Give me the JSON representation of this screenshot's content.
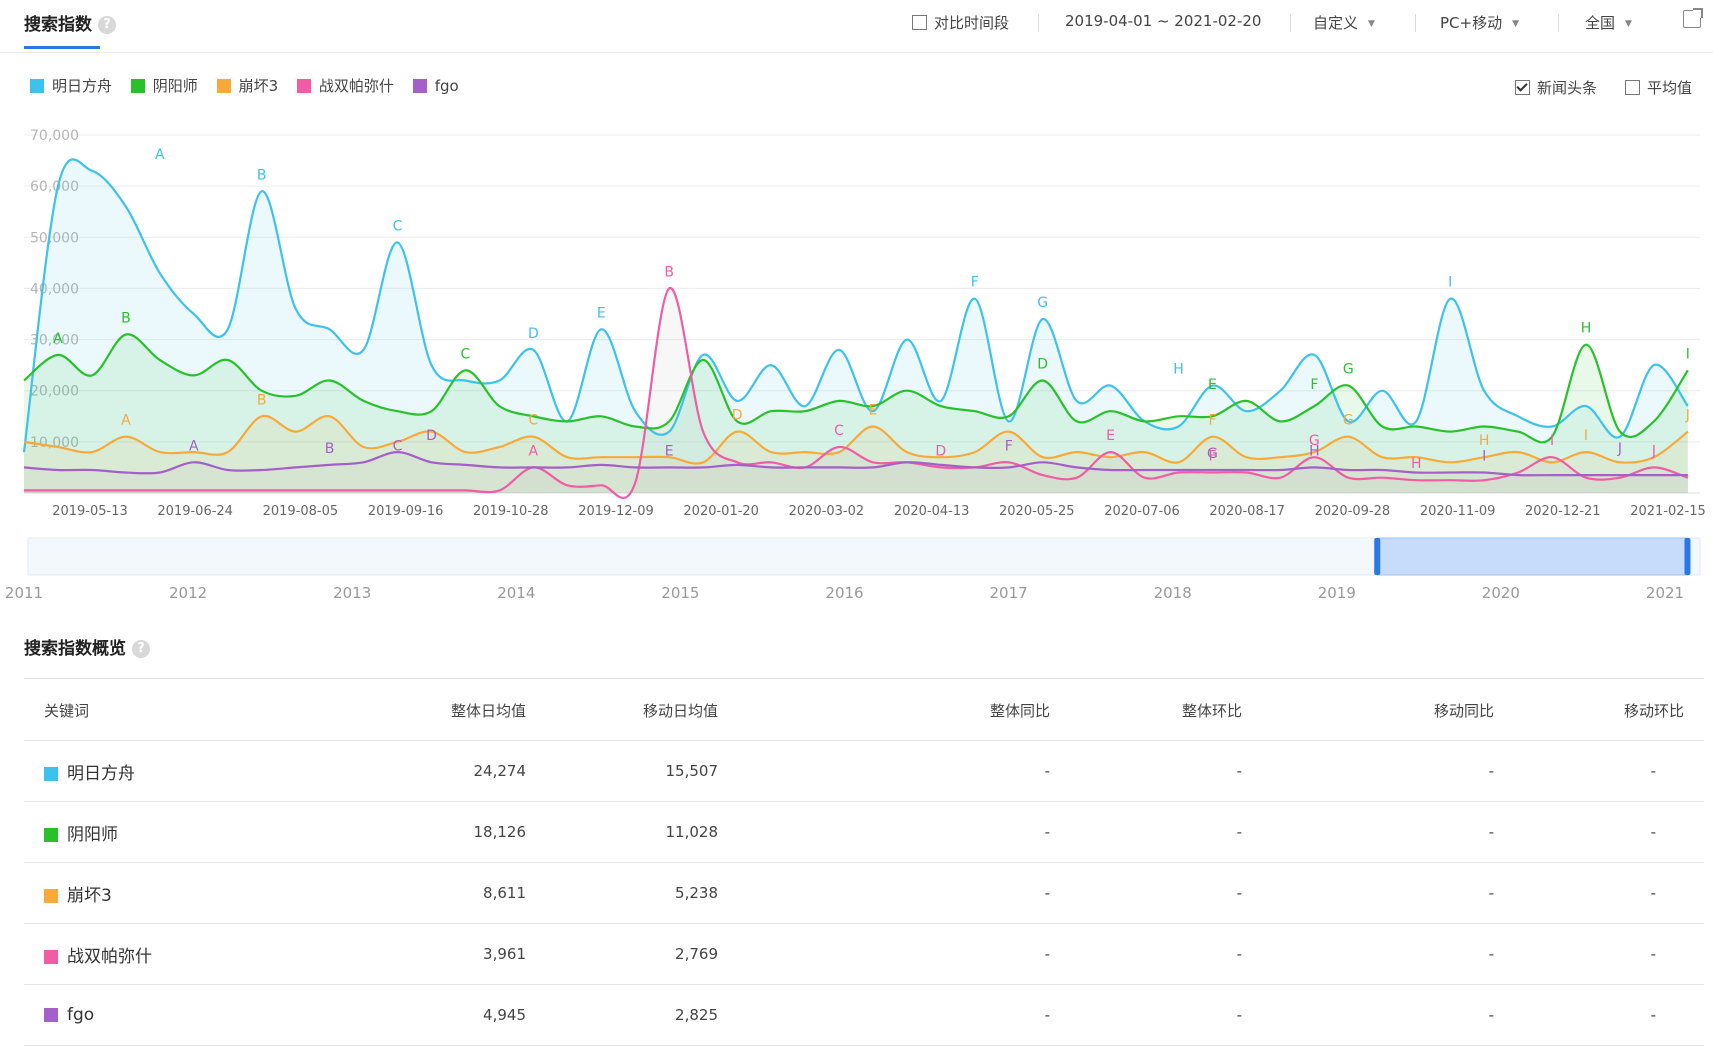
{
  "header": {
    "title": "搜索指数",
    "help_icon": "?",
    "compare_label": "对比时间段",
    "date_range": "2019-04-01 ~ 2021-02-20",
    "custom_label": "自定义",
    "device_label": "PC+移动",
    "region_label": "全国"
  },
  "legend": {
    "items": [
      {
        "name": "明日方舟",
        "color": "#3cc2ec"
      },
      {
        "name": "阴阳师",
        "color": "#28c12a"
      },
      {
        "name": "崩坏3",
        "color": "#f7a93a"
      },
      {
        "name": "战双帕弥什",
        "color": "#f15ca4"
      },
      {
        "name": "fgo",
        "color": "#a55fc8"
      }
    ],
    "news_label": "新闻头条",
    "news_checked": true,
    "avg_label": "平均值",
    "avg_checked": false
  },
  "chart_data": {
    "type": "line",
    "title": "",
    "ylim": [
      0,
      70000
    ],
    "yticks": [
      "70,000",
      "60,000",
      "50,000",
      "40,000",
      "30,000",
      "20,000",
      "10,000"
    ],
    "xtick_labels": [
      "2019-05-13",
      "2019-06-24",
      "2019-08-05",
      "2019-09-16",
      "2019-10-28",
      "2019-12-09",
      "2020-01-20",
      "2020-03-02",
      "2020-04-13",
      "2020-05-25",
      "2020-07-06",
      "2020-08-17",
      "2020-09-28",
      "2020-11-09",
      "2020-12-21",
      "2021-02-15"
    ],
    "x": [
      "2019-04-01",
      "2019-04-15",
      "2019-04-29",
      "2019-05-13",
      "2019-05-27",
      "2019-06-10",
      "2019-06-24",
      "2019-07-08",
      "2019-07-22",
      "2019-08-05",
      "2019-08-19",
      "2019-09-02",
      "2019-09-16",
      "2019-09-30",
      "2019-10-14",
      "2019-10-28",
      "2019-11-11",
      "2019-11-25",
      "2019-12-09",
      "2019-12-23",
      "2020-01-06",
      "2020-01-20",
      "2020-02-03",
      "2020-02-17",
      "2020-03-02",
      "2020-03-16",
      "2020-03-30",
      "2020-04-13",
      "2020-04-27",
      "2020-05-11",
      "2020-05-25",
      "2020-06-08",
      "2020-06-22",
      "2020-07-06",
      "2020-07-20",
      "2020-08-03",
      "2020-08-17",
      "2020-08-31",
      "2020-09-14",
      "2020-09-28",
      "2020-10-12",
      "2020-10-26",
      "2020-11-09",
      "2020-11-23",
      "2020-12-07",
      "2020-12-21",
      "2021-01-04",
      "2021-01-18",
      "2021-02-01",
      "2021-02-15"
    ],
    "series": [
      {
        "name": "明日方舟",
        "color": "#3cc2ec",
        "fill": true,
        "values": [
          8000,
          60000,
          63000,
          56000,
          43000,
          35000,
          32000,
          59000,
          36000,
          32000,
          28000,
          49000,
          25000,
          22000,
          22000,
          28000,
          14000,
          32000,
          16000,
          12000,
          27000,
          18000,
          25000,
          17000,
          28000,
          16000,
          30000,
          18000,
          38000,
          14000,
          34000,
          18000,
          21000,
          14000,
          13000,
          21000,
          16000,
          20000,
          27000,
          14000,
          20000,
          14000,
          38000,
          20000,
          15000,
          13000,
          17000,
          11000,
          25000,
          17000
        ]
      },
      {
        "name": "阴阳师",
        "color": "#28c12a",
        "fill": true,
        "values": [
          22000,
          27000,
          23000,
          31000,
          26000,
          23000,
          26000,
          20000,
          19000,
          22000,
          18000,
          16000,
          16000,
          24000,
          17000,
          15000,
          14000,
          15000,
          13000,
          14000,
          26000,
          14000,
          16000,
          16000,
          18000,
          17000,
          20000,
          17000,
          16000,
          15000,
          22000,
          14000,
          16000,
          14000,
          15000,
          15000,
          18000,
          14000,
          17000,
          21000,
          13000,
          13000,
          12000,
          13000,
          12000,
          11000,
          29000,
          12000,
          14000,
          24000
        ]
      },
      {
        "name": "崩坏3",
        "color": "#f7a93a",
        "fill": true,
        "values": [
          10000,
          9000,
          8000,
          11000,
          8000,
          8000,
          8000,
          15000,
          12000,
          15000,
          9000,
          10000,
          12000,
          8000,
          9000,
          11000,
          7000,
          7000,
          7000,
          7000,
          6000,
          12000,
          8000,
          8000,
          8000,
          13000,
          8000,
          7000,
          8000,
          12000,
          7000,
          8000,
          7000,
          8000,
          6000,
          11000,
          7000,
          7000,
          8000,
          11000,
          7000,
          7000,
          6000,
          7000,
          8000,
          6000,
          8000,
          6000,
          7000,
          12000
        ]
      },
      {
        "name": "战双帕弥什",
        "color": "#f15ca4",
        "fill": false,
        "values": [
          500,
          500,
          500,
          500,
          500,
          500,
          500,
          500,
          500,
          500,
          500,
          500,
          500,
          500,
          500,
          5000,
          1500,
          1500,
          2000,
          40000,
          12000,
          6000,
          6000,
          5000,
          9000,
          6000,
          6000,
          5000,
          5000,
          6000,
          3500,
          3000,
          8000,
          3000,
          4000,
          4000,
          4000,
          3000,
          7000,
          3000,
          3000,
          2500,
          2500,
          2500,
          4000,
          7000,
          3000,
          3000,
          5000,
          3000
        ]
      },
      {
        "name": "fgo",
        "color": "#a55fc8",
        "fill": false,
        "values": [
          5000,
          4500,
          4500,
          4000,
          4000,
          6000,
          4500,
          4500,
          5000,
          5500,
          6000,
          8000,
          6000,
          5500,
          5000,
          5000,
          5000,
          5500,
          5000,
          5000,
          5000,
          5500,
          5000,
          5000,
          5000,
          5000,
          6000,
          5500,
          5000,
          5000,
          6000,
          5000,
          4500,
          4500,
          4500,
          4500,
          4500,
          4500,
          5000,
          4500,
          4500,
          4000,
          4000,
          4000,
          3500,
          3500,
          3500,
          3500,
          3500,
          3500
        ]
      }
    ],
    "annotations": [
      {
        "series": 0,
        "label": "A",
        "x": "2019-05-27",
        "y": 63000
      },
      {
        "series": 0,
        "label": "B",
        "x": "2019-07-08",
        "y": 59000
      },
      {
        "series": 0,
        "label": "C",
        "x": "2019-09-02",
        "y": 49000
      },
      {
        "series": 0,
        "label": "D",
        "x": "2019-10-28",
        "y": 28000
      },
      {
        "series": 0,
        "label": "E",
        "x": "2019-11-25",
        "y": 32000
      },
      {
        "series": 0,
        "label": "F",
        "x": "2020-04-27",
        "y": 38000
      },
      {
        "series": 0,
        "label": "G",
        "x": "2020-05-25",
        "y": 34000
      },
      {
        "series": 0,
        "label": "H",
        "x": "2020-07-20",
        "y": 21000
      },
      {
        "series": 0,
        "label": "I",
        "x": "2020-11-09",
        "y": 38000
      },
      {
        "series": 1,
        "label": "A",
        "x": "2019-04-15",
        "y": 27000
      },
      {
        "series": 1,
        "label": "B",
        "x": "2019-05-13",
        "y": 31000
      },
      {
        "series": 1,
        "label": "C",
        "x": "2019-09-30",
        "y": 24000
      },
      {
        "series": 1,
        "label": "D",
        "x": "2020-05-25",
        "y": 22000
      },
      {
        "series": 1,
        "label": "E",
        "x": "2020-08-03",
        "y": 18000
      },
      {
        "series": 1,
        "label": "F",
        "x": "2020-09-14",
        "y": 18000
      },
      {
        "series": 1,
        "label": "G",
        "x": "2020-09-28",
        "y": 21000
      },
      {
        "series": 1,
        "label": "H",
        "x": "2021-01-04",
        "y": 29000
      },
      {
        "series": 1,
        "label": "I",
        "x": "2021-02-15",
        "y": 24000
      },
      {
        "series": 2,
        "label": "A",
        "x": "2019-05-13",
        "y": 11000
      },
      {
        "series": 2,
        "label": "B",
        "x": "2019-07-08",
        "y": 15000
      },
      {
        "series": 2,
        "label": "C",
        "x": "2019-10-28",
        "y": 11000
      },
      {
        "series": 2,
        "label": "D",
        "x": "2020-01-20",
        "y": 12000
      },
      {
        "series": 2,
        "label": "E",
        "x": "2020-03-16",
        "y": 13000
      },
      {
        "series": 2,
        "label": "F",
        "x": "2020-08-03",
        "y": 11000
      },
      {
        "series": 2,
        "label": "G",
        "x": "2020-09-28",
        "y": 11000
      },
      {
        "series": 2,
        "label": "H",
        "x": "2020-11-23",
        "y": 7000
      },
      {
        "series": 2,
        "label": "I",
        "x": "2021-01-04",
        "y": 8000
      },
      {
        "series": 2,
        "label": "J",
        "x": "2021-02-15",
        "y": 12000
      },
      {
        "series": 3,
        "label": "A",
        "x": "2019-10-28",
        "y": 5000
      },
      {
        "series": 3,
        "label": "B",
        "x": "2019-12-23",
        "y": 40000
      },
      {
        "series": 3,
        "label": "C",
        "x": "2020-03-02",
        "y": 9000
      },
      {
        "series": 3,
        "label": "D",
        "x": "2020-04-13",
        "y": 5000
      },
      {
        "series": 3,
        "label": "E",
        "x": "2020-06-22",
        "y": 8000
      },
      {
        "series": 3,
        "label": "F",
        "x": "2020-08-03",
        "y": 4000
      },
      {
        "series": 3,
        "label": "G",
        "x": "2020-09-14",
        "y": 7000
      },
      {
        "series": 3,
        "label": "H",
        "x": "2020-10-26",
        "y": 2500
      },
      {
        "series": 3,
        "label": "I",
        "x": "2020-12-21",
        "y": 7000
      },
      {
        "series": 3,
        "label": "J",
        "x": "2021-02-01",
        "y": 5000
      },
      {
        "series": 4,
        "label": "A",
        "x": "2019-06-10",
        "y": 6000
      },
      {
        "series": 4,
        "label": "B",
        "x": "2019-08-05",
        "y": 5500
      },
      {
        "series": 4,
        "label": "C",
        "x": "2019-09-02",
        "y": 6000
      },
      {
        "series": 4,
        "label": "D",
        "x": "2019-09-16",
        "y": 8000
      },
      {
        "series": 4,
        "label": "E",
        "x": "2019-12-23",
        "y": 5000
      },
      {
        "series": 4,
        "label": "F",
        "x": "2020-05-11",
        "y": 6000
      },
      {
        "series": 4,
        "label": "G",
        "x": "2020-08-03",
        "y": 4500
      },
      {
        "series": 4,
        "label": "H",
        "x": "2020-09-14",
        "y": 5000
      },
      {
        "series": 4,
        "label": "I",
        "x": "2020-11-23",
        "y": 4000
      },
      {
        "series": 4,
        "label": "J",
        "x": "2021-01-18",
        "y": 5500
      }
    ],
    "overview_years": [
      "2011",
      "2012",
      "2013",
      "2014",
      "2015",
      "2016",
      "2017",
      "2018",
      "2019",
      "2020",
      "2021"
    ],
    "overview_window": [
      "2019-04-01",
      "2021-02-20"
    ],
    "grid": true,
    "legend": "top-left"
  },
  "summary": {
    "title": "搜索指数概览",
    "help_icon": "?",
    "columns": [
      "关键词",
      "整体日均值",
      "移动日均值",
      "整体同比",
      "整体环比",
      "移动同比",
      "移动环比"
    ],
    "rows": [
      {
        "keyword": "明日方舟",
        "color": "#3cc2ec",
        "overall": "24,274",
        "mobile": "15,507",
        "yoy": "-",
        "mom": "-",
        "m_yoy": "-",
        "m_mom": "-"
      },
      {
        "keyword": "阴阳师",
        "color": "#28c12a",
        "overall": "18,126",
        "mobile": "11,028",
        "yoy": "-",
        "mom": "-",
        "m_yoy": "-",
        "m_mom": "-"
      },
      {
        "keyword": "崩坏3",
        "color": "#f7a93a",
        "overall": "8,611",
        "mobile": "5,238",
        "yoy": "-",
        "mom": "-",
        "m_yoy": "-",
        "m_mom": "-"
      },
      {
        "keyword": "战双帕弥什",
        "color": "#f15ca4",
        "overall": "3,961",
        "mobile": "2,769",
        "yoy": "-",
        "mom": "-",
        "m_yoy": "-",
        "m_mom": "-"
      },
      {
        "keyword": "fgo",
        "color": "#a55fc8",
        "overall": "4,945",
        "mobile": "2,825",
        "yoy": "-",
        "mom": "-",
        "m_yoy": "-",
        "m_mom": "-"
      }
    ]
  }
}
